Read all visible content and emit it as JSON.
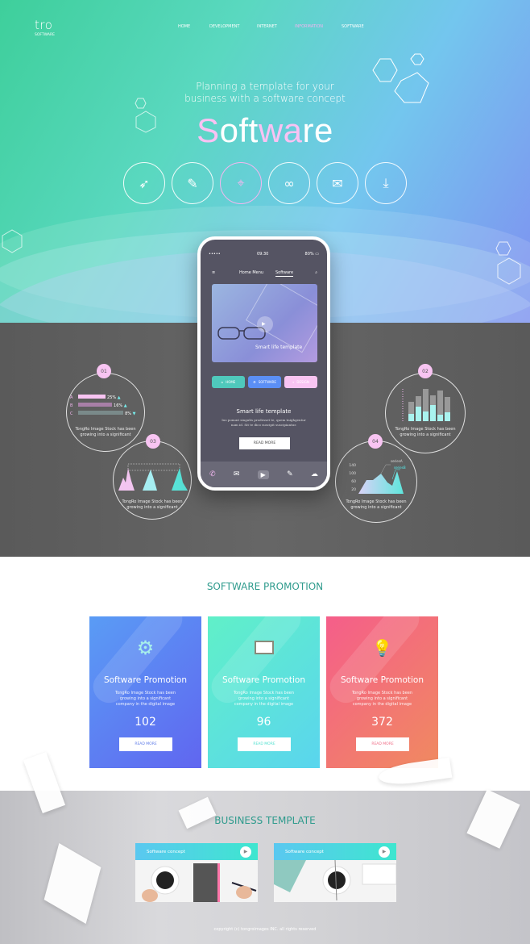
{
  "logo": {
    "name": "tro",
    "subtitle": "SOFTWARE"
  },
  "nav": [
    {
      "label": "HOME"
    },
    {
      "label": "DEVELOPMENT"
    },
    {
      "label": "INTERNET"
    },
    {
      "label": "INFORMATION",
      "active": true
    },
    {
      "label": "SOFTWARE"
    }
  ],
  "hero": {
    "tagline_1": "Planning a template for your",
    "tagline_2": "business with a software concept",
    "title_parts": [
      "S",
      "oft",
      "wa",
      "re"
    ],
    "icons": [
      "cursor-click-icon",
      "edit-document-icon",
      "map-pin-icon",
      "link-icon",
      "mail-icon",
      "download-icon"
    ]
  },
  "phone": {
    "signal": "•••••",
    "time": "09:30",
    "battery": "80%",
    "menu": "Home Menu",
    "tab": "Software",
    "image_caption": "Smart life template",
    "buttons": [
      {
        "label": "HOME",
        "icon": "home-icon",
        "color": "#4fc9bc"
      },
      {
        "label": "SOFTWARE",
        "icon": "gear-icon",
        "color": "#5b8ff5"
      },
      {
        "label": "DESIGN",
        "icon": "search-icon",
        "color": "#f8c4f2"
      }
    ],
    "heading": "Smart life template",
    "body": "Ius ponunt singulis prodesset te, quem tnighgentur nam id. Sit te dico suscipit suscipiantur.",
    "read_more": "READ MORE",
    "footer_icons": [
      "phone-icon",
      "mail-icon",
      "play-icon",
      "edit-icon",
      "cloud-icon"
    ]
  },
  "infographics": [
    {
      "badge": "01",
      "text_1": "TongRo Image Stock has been",
      "text_2": "growing into a significant",
      "rows": [
        {
          "label": "A",
          "value": "25%",
          "trend": "up"
        },
        {
          "label": "B",
          "value": "16%",
          "trend": "up"
        },
        {
          "label": "C",
          "value": "8%",
          "trend": "down"
        }
      ]
    },
    {
      "badge": "02",
      "text_1": "TongRo Image Stock has been",
      "text_2": "growing into a significant"
    },
    {
      "badge": "03",
      "text_1": "TongRo Image Stock has been",
      "text_2": "growing into a significant"
    },
    {
      "badge": "04",
      "text_1": "TongRo Image Stock has been",
      "text_2": "growing into a significant",
      "y_ticks": [
        "140",
        "100",
        "60",
        "20"
      ],
      "series": [
        "seriesA",
        "seriesB"
      ]
    }
  ],
  "promotion": {
    "title": "SOFTWARE PROMOTION",
    "cards": [
      {
        "title": "Software Promotion",
        "text": "TongRo Image Stock has been growing into a significant company in the digital image",
        "count": "102",
        "button": "READ MORE",
        "icon": "gears-icon",
        "color": "#5d7af0"
      },
      {
        "title": "Software Promotion",
        "text": "TongRo Image Stock has been growing into a significant company in the digital image",
        "count": "96",
        "button": "READ MORE",
        "icon": "monitor-icon",
        "color": "#4fe0cf"
      },
      {
        "title": "Software Promotion",
        "text": "TongRo Image Stock has been growing into a significant company in the digital image",
        "count": "372",
        "button": "READ MORE",
        "icon": "lightbulb-icon",
        "color": "#f06a84"
      }
    ]
  },
  "business": {
    "title": "BUSINESS TEMPLATE",
    "cards": [
      {
        "title": "Software concept"
      },
      {
        "title": "Software concept"
      }
    ]
  },
  "footer": {
    "copyright": "copyright (c) tongroimages INC. all rights reserved"
  }
}
